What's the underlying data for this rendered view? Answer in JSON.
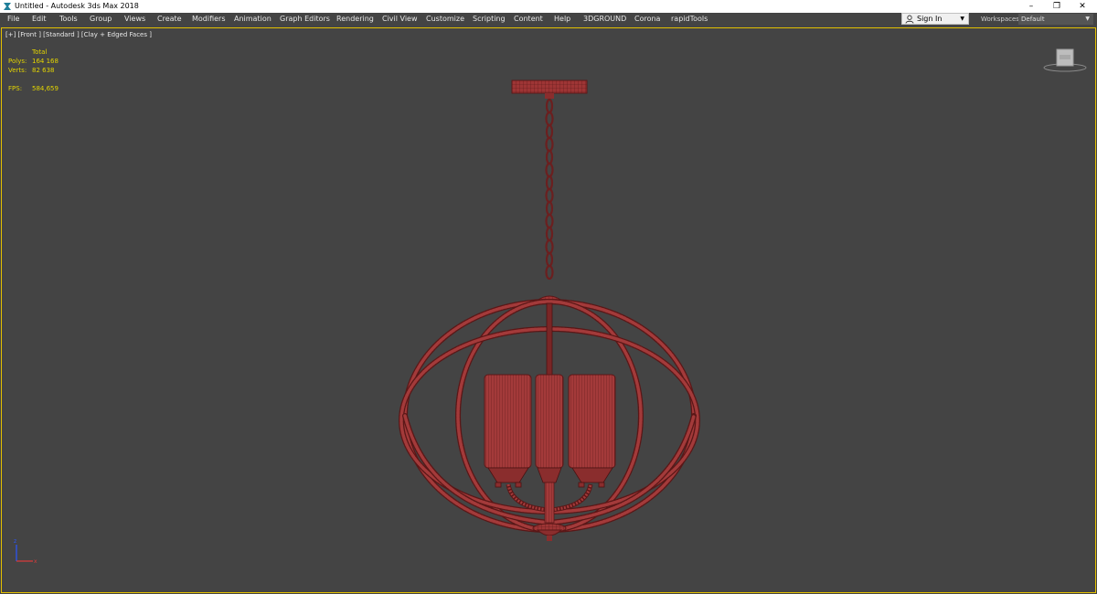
{
  "window": {
    "title": "Untitled - Autodesk 3ds Max 2018",
    "controls": [
      "–",
      "❐",
      "✕"
    ]
  },
  "menu": {
    "items": [
      "File",
      "Edit",
      "Tools",
      "Group",
      "Views",
      "Create",
      "Modifiers",
      "Animation",
      "Graph Editors",
      "Rendering",
      "Civil View",
      "Customize",
      "Scripting",
      "Content",
      "Help",
      "3DGROUND",
      "Corona",
      "rapidTools"
    ]
  },
  "account": {
    "sign_in_label": "Sign In",
    "workspaces_label": "Workspaces:",
    "workspace_value": "Default"
  },
  "viewport": {
    "label": "[+] [Front ] [Standard ] [Clay + Edged Faces ]",
    "stats": {
      "header": "Total",
      "polys_label": "Polys:",
      "polys_value": "164 168",
      "verts_label": "Verts:",
      "verts_value": "82 638",
      "fps_label": "FPS:",
      "fps_value": "584,659"
    },
    "viewcube_label": "FRONT"
  },
  "colors": {
    "viewport_bg": "#444444",
    "active_border": "#e3c000",
    "stats_text": "#e3d400",
    "wire_red": "#a33a3a",
    "wire_dark": "#5a1717"
  },
  "icons": {
    "app": "3dsmax-logo-icon",
    "user": "user-icon",
    "dropdown": "chevron-down-icon"
  }
}
